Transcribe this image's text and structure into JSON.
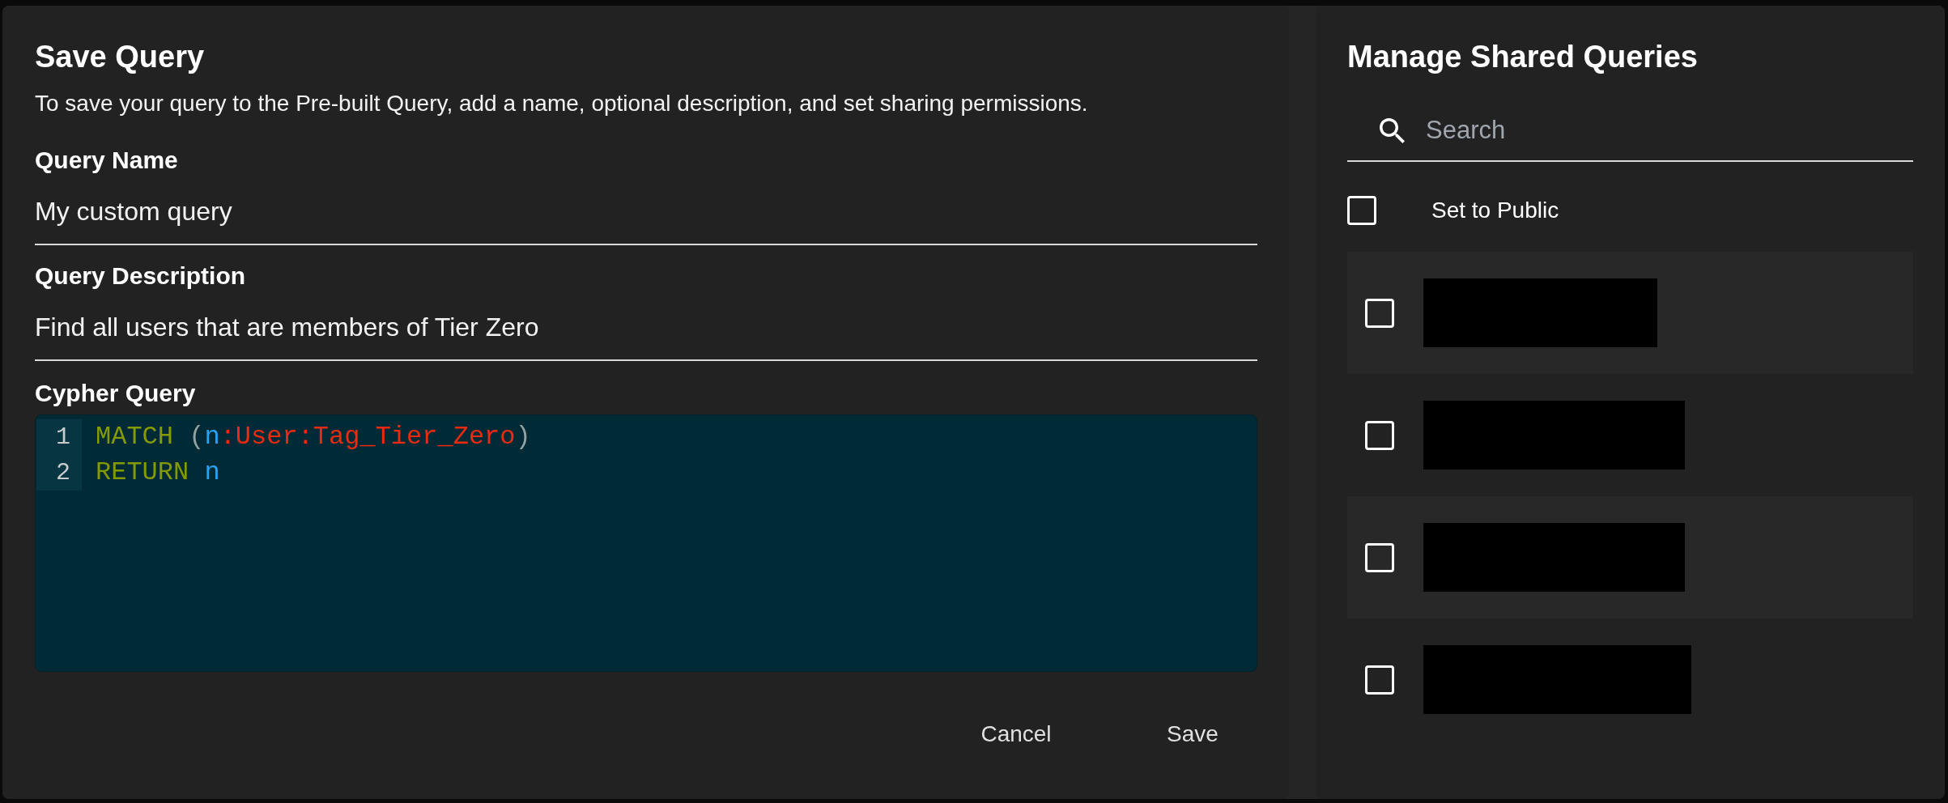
{
  "save_query": {
    "title": "Save Query",
    "description": "To save your query to the Pre-built Query, add a name, optional description, and set sharing permissions.",
    "fields": [
      {
        "label": "Query Name",
        "value": "My custom query"
      },
      {
        "label": "Query Description",
        "value": "Find all users that are members of Tier Zero"
      }
    ],
    "cypher_query": {
      "label": "Cypher Query",
      "lines": [
        {
          "number": "1",
          "tokens": [
            {
              "kind": "keyword",
              "text": "MATCH "
            },
            {
              "kind": "punctuation",
              "text": "("
            },
            {
              "kind": "variable",
              "text": "n"
            },
            {
              "kind": "label",
              "text": ":User:Tag_Tier_Zero"
            },
            {
              "kind": "punctuation",
              "text": ")"
            }
          ]
        },
        {
          "number": "2",
          "tokens": [
            {
              "kind": "keyword",
              "text": "RETURN "
            },
            {
              "kind": "variable",
              "text": "n"
            }
          ]
        }
      ]
    },
    "buttons": [
      {
        "label": "Cancel"
      },
      {
        "label": "Save"
      }
    ]
  },
  "manage_shared_queries": {
    "title": "Manage Shared Queries",
    "search": {
      "placeholder": "Search"
    },
    "set_to_public": {
      "label": "Set to Public",
      "checked": false
    },
    "queries": [
      {
        "checked": false,
        "redacted": true
      },
      {
        "checked": false,
        "redacted": true
      },
      {
        "checked": false,
        "redacted": true
      },
      {
        "checked": false,
        "redacted": true
      }
    ]
  }
}
